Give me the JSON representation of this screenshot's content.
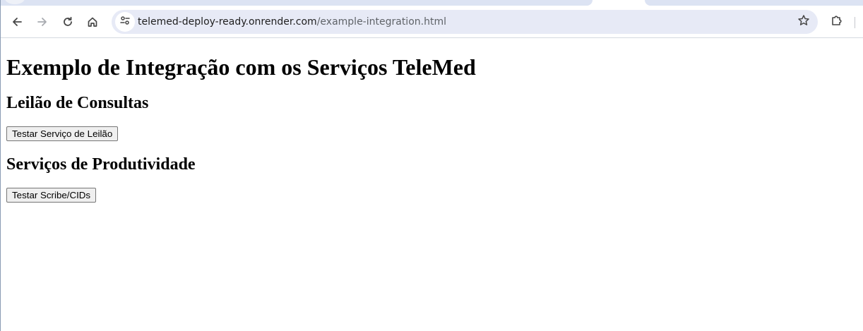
{
  "browser": {
    "url_host": "telemed-deploy-ready.onrender.com",
    "url_path": "/example-integration.html",
    "icons": {
      "back": "arrow-left-icon",
      "forward": "arrow-right-icon",
      "reload": "reload-icon",
      "home": "home-icon",
      "site_info": "tune-icon",
      "bookmark": "star-icon",
      "extensions": "puzzle-icon"
    }
  },
  "page": {
    "title": "Exemplo de Integração com os Serviços TeleMed",
    "sections": [
      {
        "heading": "Leilão de Consultas",
        "button_label": "Testar Serviço de Leilão"
      },
      {
        "heading": "Serviços de Produtividade",
        "button_label": "Testar Scribe/CIDs"
      }
    ]
  }
}
